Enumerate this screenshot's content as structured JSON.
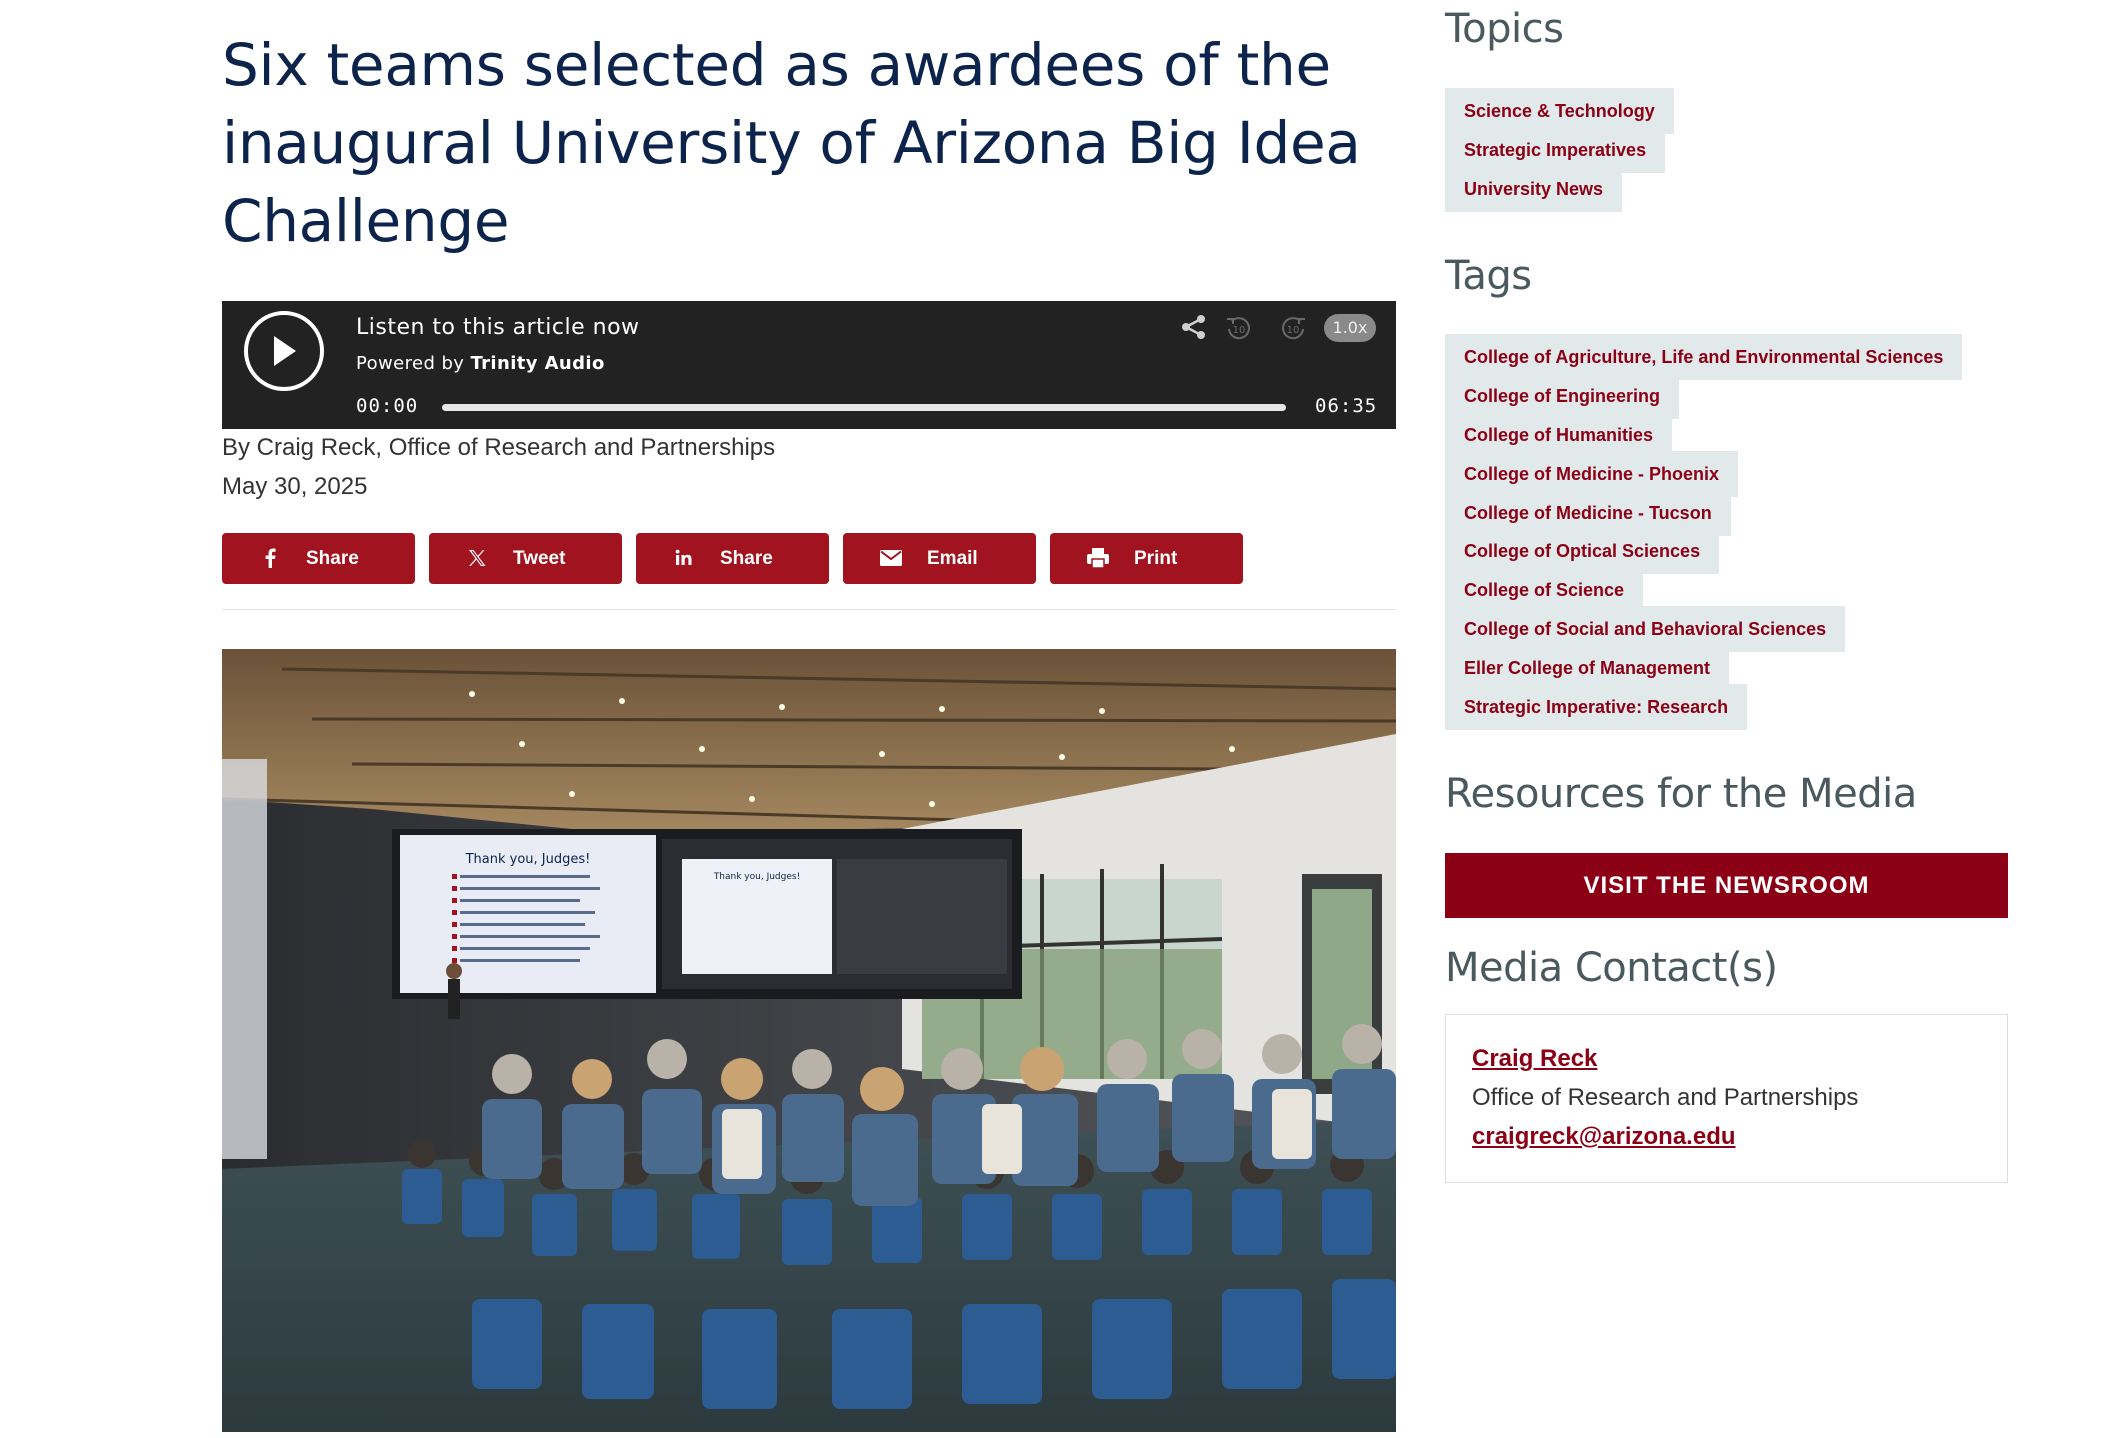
{
  "article": {
    "title": "Six teams selected as awardees of the inaugural University of Arizona Big Idea Challenge",
    "byline": "By Craig Reck, Office of Research and Partnerships",
    "date": "May 30, 2025"
  },
  "audio_player": {
    "listen_text": "Listen to this article now",
    "powered_prefix": "Powered by",
    "powered_brand": "Trinity Audio",
    "current_time": "00:00",
    "duration": "06:35",
    "speed": "1.0x",
    "skip_back_label": "10",
    "skip_forward_label": "10",
    "progress_fraction": 0.0
  },
  "share_buttons": [
    {
      "label": "Share",
      "icon": "facebook-icon"
    },
    {
      "label": "Tweet",
      "icon": "x-twitter-icon"
    },
    {
      "label": "Share",
      "icon": "linkedin-icon"
    },
    {
      "label": "Email",
      "icon": "email-icon"
    },
    {
      "label": "Print",
      "icon": "printer-icon"
    }
  ],
  "sidebar": {
    "topics_heading": "Topics",
    "topics": [
      "Science & Technology",
      "Strategic Imperatives",
      "University News"
    ],
    "tags_heading": "Tags",
    "tags": [
      "College of Agriculture, Life and Environmental Sciences",
      "College of Engineering",
      "College of Humanities",
      "College of Medicine - Phoenix",
      "College of Medicine - Tucson",
      "College of Optical Sciences",
      "College of Science",
      "College of Social and Behavioral Sciences",
      "Eller College of Management",
      "Strategic Imperative: Research"
    ],
    "media_heading": "Resources for the Media",
    "newsroom_button": "VISIT THE NEWSROOM",
    "contacts_heading": "Media Contact(s)",
    "contact": {
      "name": "Craig Reck",
      "org": "Office of Research and Partnerships",
      "email": "craigreck@arizona.edu"
    }
  },
  "colors": {
    "title_navy": "#0c234b",
    "brand_red": "#a1131f",
    "tag_text": "#8b0015",
    "tag_bg": "#e2e9eb",
    "heading_gray": "#49595e",
    "player_bg": "#222222"
  },
  "photo": {
    "screen_left_heading": "Thank you, Judges!",
    "screen_right_heading": "Thank you, Judges!"
  }
}
